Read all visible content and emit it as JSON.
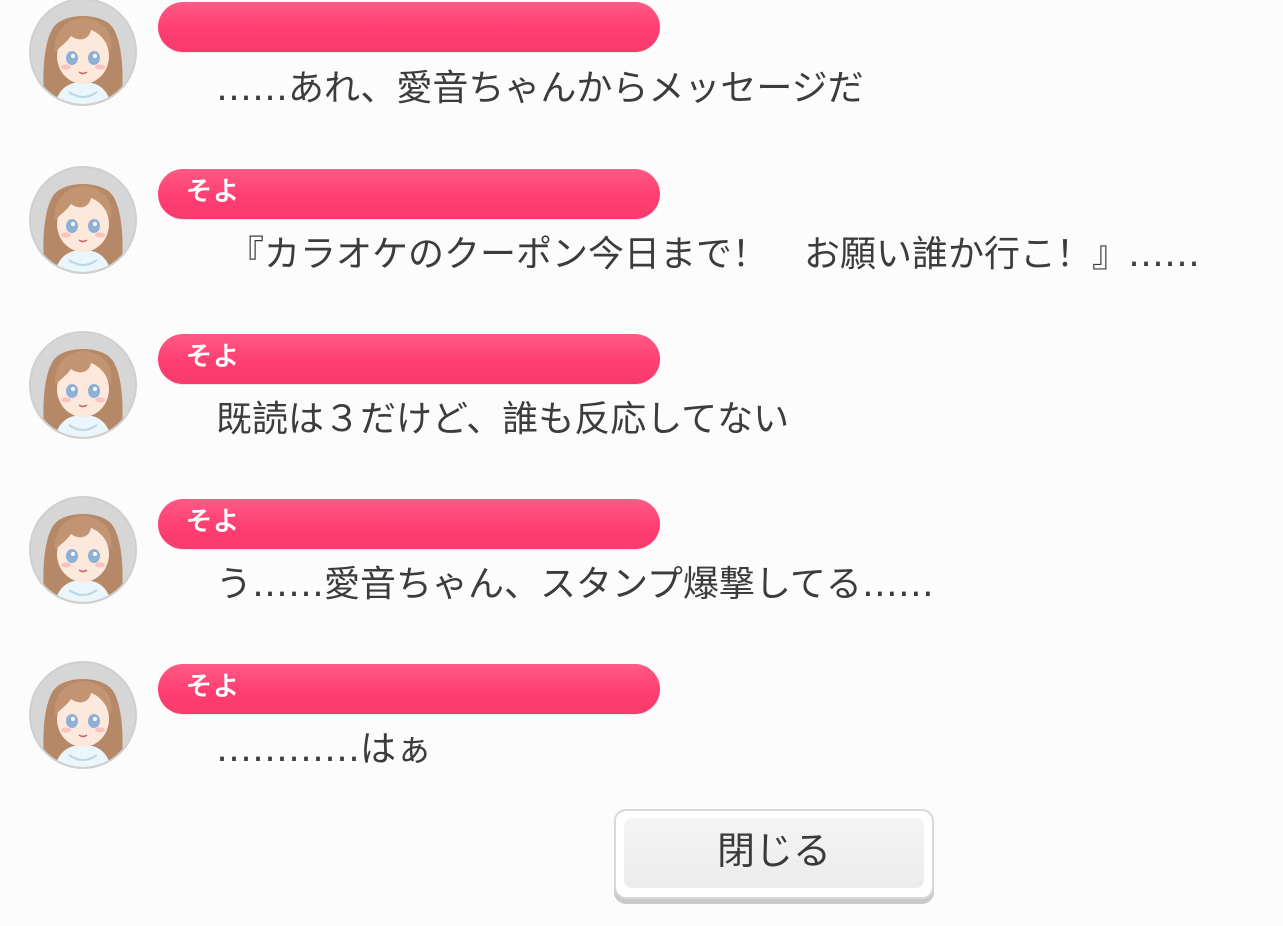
{
  "backlog": {
    "entries": [
      {
        "speaker": "",
        "message": "……あれ、愛音ちゃんからメッセージだ"
      },
      {
        "speaker": "そよ",
        "message": "『カラオケのクーポン今日まで！　お願い誰か行こ！』……"
      },
      {
        "speaker": "そよ",
        "message": "既読は３だけど、誰も反応してない"
      },
      {
        "speaker": "そよ",
        "message": "う……愛音ちゃん、スタンプ爆撃してる……"
      },
      {
        "speaker": "そよ",
        "message": "…………はぁ"
      }
    ]
  },
  "footer": {
    "close_label": "閉じる"
  },
  "colors": {
    "name_pill": "#ff4576",
    "message_text": "#3c3c3c",
    "background": "#fcfcfc"
  },
  "icons": {
    "speaker_avatar": "character-portrait-icon"
  }
}
